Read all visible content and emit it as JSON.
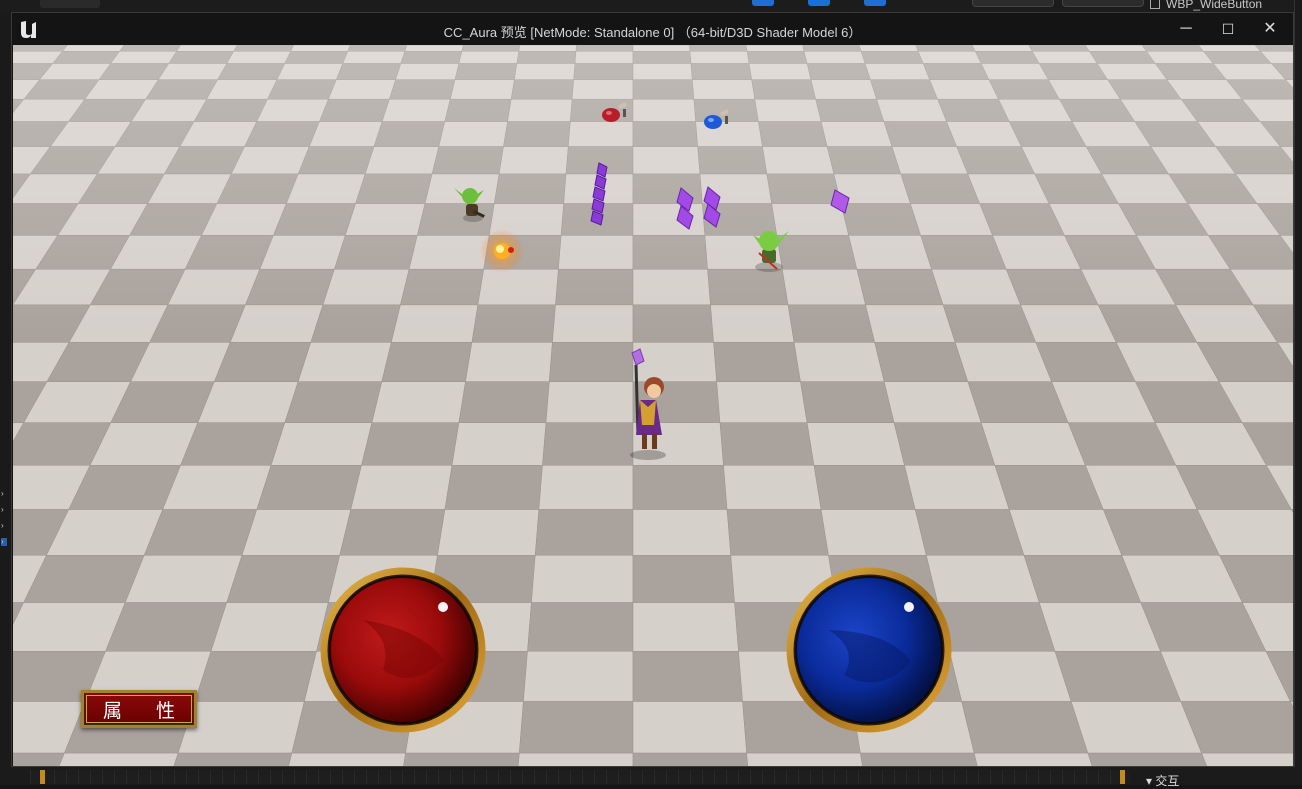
{
  "window": {
    "title": "CC_Aura 预览 [NetMode: Standalone 0] （64-bit/D3D Shader Model 6）",
    "minimize_glyph": "─",
    "maximize_glyph": "☐",
    "close_glyph": "✕"
  },
  "editor_background": {
    "top_right_label": "WBP_WideButton",
    "bottom_right_label": "交互"
  },
  "hud": {
    "attribute_button_label": "属 性",
    "health_globe_color": "#9b0b0b",
    "mana_globe_color": "#0a2b9a",
    "globe_frame_color": "#c08a20"
  },
  "scene": {
    "floor_light": "#d6d0cb",
    "floor_dark": "#aaa39d"
  }
}
